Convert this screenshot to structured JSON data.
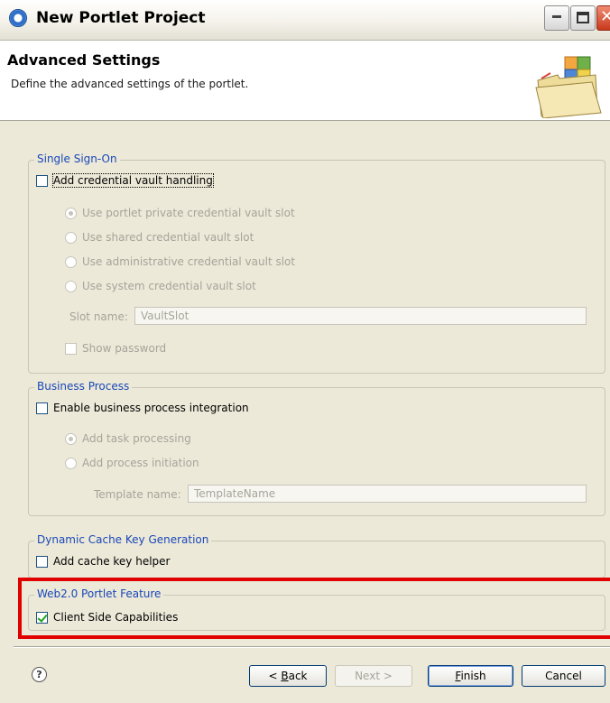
{
  "window": {
    "title": "New Portlet Project"
  },
  "header": {
    "title": "Advanced Settings",
    "description": "Define the advanced settings of the portlet.",
    "icon": "folder-wizard-icon"
  },
  "sso": {
    "label": "Single Sign-On",
    "vault_checkbox": {
      "label": "Add credential vault handling",
      "checked": false
    },
    "options": [
      {
        "label": "Use portlet private credential vault slot",
        "selected": true
      },
      {
        "label": "Use shared credential vault slot",
        "selected": false
      },
      {
        "label": "Use administrative credential vault slot",
        "selected": false
      },
      {
        "label": "Use system credential vault slot",
        "selected": false
      }
    ],
    "slot_name_label": "Slot name:",
    "slot_name_value": "VaultSlot",
    "show_password": {
      "label": "Show password",
      "checked": false
    }
  },
  "business": {
    "label": "Business Process",
    "enable_checkbox": {
      "label": "Enable business process integration",
      "checked": false
    },
    "options": [
      {
        "label": "Add task processing",
        "selected": true
      },
      {
        "label": "Add process initiation",
        "selected": false
      }
    ],
    "template_name_label": "Template name:",
    "template_name_value": "TemplateName"
  },
  "cache": {
    "label": "Dynamic Cache Key Generation",
    "checkbox": {
      "label": "Add cache key helper",
      "checked": false
    }
  },
  "web20": {
    "label": "Web2.0 Portlet Feature",
    "checkbox": {
      "label": "Client Side Capabilities",
      "checked": true
    }
  },
  "buttons": {
    "help": "?",
    "back_prefix": "< ",
    "back_mnemonic": "B",
    "back_rest": "ack",
    "next": "Next >",
    "finish_mnemonic": "F",
    "finish_rest": "inish",
    "cancel": "Cancel"
  },
  "colors": {
    "group_label": "#1847b8",
    "highlight": "#e00000",
    "dialog_bg": "#ece9d8"
  }
}
